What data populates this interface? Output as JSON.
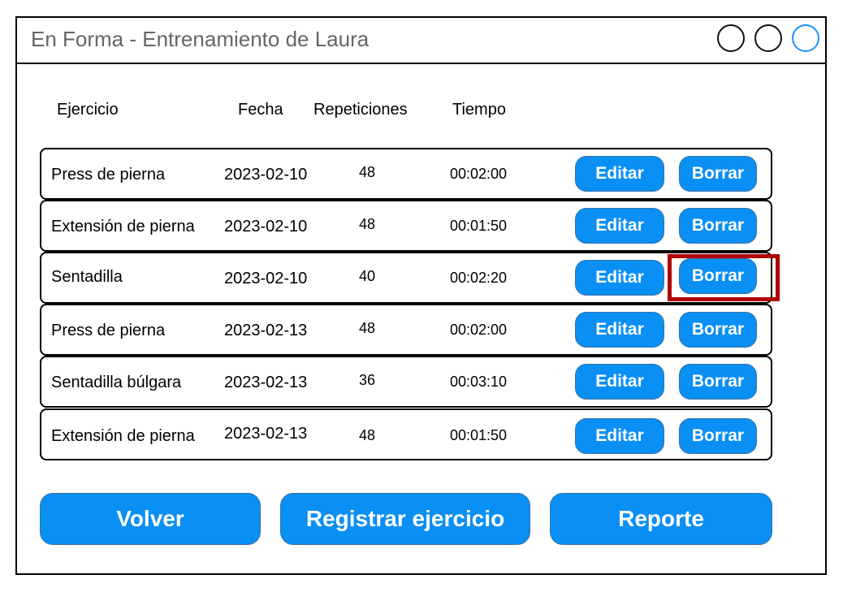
{
  "window": {
    "title": "En Forma - Entrenamiento de Laura"
  },
  "table": {
    "headers": {
      "ejercicio": "Ejercicio",
      "fecha": "Fecha",
      "repeticiones": "Repeticiones",
      "tiempo": "Tiempo"
    },
    "rows": [
      {
        "name": "Press de pierna",
        "date": "2023-02-10",
        "reps": "48",
        "time": "00:02:00",
        "edit": "Editar",
        "delete": "Borrar"
      },
      {
        "name": "Extensión de pierna",
        "date": "2023-02-10",
        "reps": "48",
        "time": "00:01:50",
        "edit": "Editar",
        "delete": "Borrar"
      },
      {
        "name": "Sentadilla",
        "date": "2023-02-10",
        "reps": "40",
        "time": "00:02:20",
        "edit": "Editar",
        "delete": "Borrar"
      },
      {
        "name": "Press de pierna",
        "date": "2023-02-13",
        "reps": "48",
        "time": "00:02:00",
        "edit": "Editar",
        "delete": "Borrar"
      },
      {
        "name": "Sentadilla búlgara",
        "date": "2023-02-13",
        "reps": "36",
        "time": "00:03:10",
        "edit": "Editar",
        "delete": "Borrar"
      },
      {
        "name": "Extensión de pierna",
        "date": "2023-02-13",
        "reps": "48",
        "time": "00:01:50",
        "edit": "Editar",
        "delete": "Borrar"
      }
    ]
  },
  "footer": {
    "volver": "Volver",
    "registrar": "Registrar ejercicio",
    "reporte": "Reporte"
  },
  "colors": {
    "button": "#0a8ff5",
    "highlight": "#b00000",
    "close_control": "#1e90ff"
  }
}
